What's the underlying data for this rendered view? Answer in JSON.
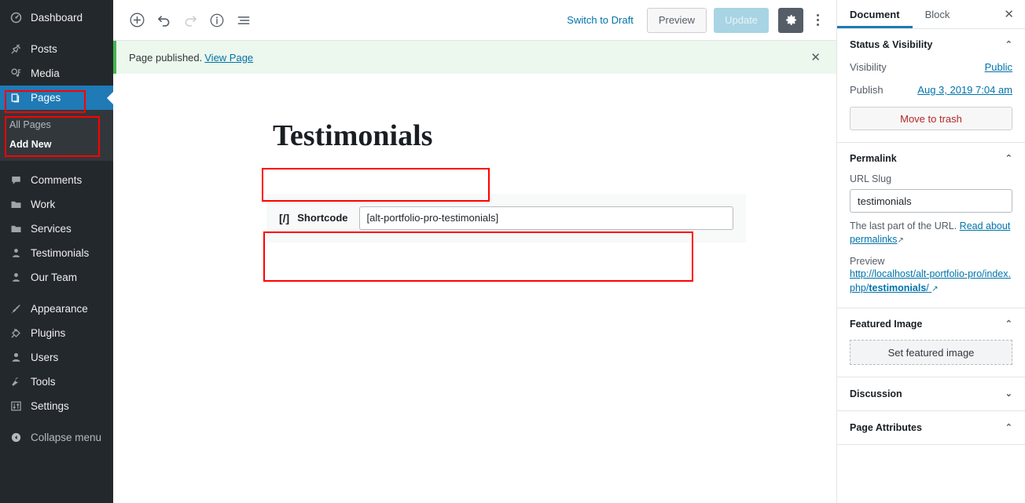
{
  "admin_menu": {
    "items": [
      {
        "label": "Dashboard",
        "icon": "dashboard-icon",
        "state": "normal"
      },
      {
        "label": "Posts",
        "icon": "pin-icon",
        "state": "normal"
      },
      {
        "label": "Media",
        "icon": "media-icon",
        "state": "normal"
      },
      {
        "label": "Pages",
        "icon": "pages-icon",
        "state": "current"
      },
      {
        "label": "Comments",
        "icon": "comment-icon",
        "state": "normal"
      },
      {
        "label": "Work",
        "icon": "folder-icon",
        "state": "normal"
      },
      {
        "label": "Services",
        "icon": "folder-icon",
        "state": "normal"
      },
      {
        "label": "Testimonials",
        "icon": "user-icon",
        "state": "normal"
      },
      {
        "label": "Our Team",
        "icon": "user-icon",
        "state": "normal"
      },
      {
        "label": "Appearance",
        "icon": "brush-icon",
        "state": "normal"
      },
      {
        "label": "Plugins",
        "icon": "plug-icon",
        "state": "normal"
      },
      {
        "label": "Users",
        "icon": "users-icon",
        "state": "normal"
      },
      {
        "label": "Tools",
        "icon": "wrench-icon",
        "state": "normal"
      },
      {
        "label": "Settings",
        "icon": "sliders-icon",
        "state": "normal"
      },
      {
        "label": "Collapse menu",
        "icon": "collapse-icon",
        "state": "collapse"
      }
    ],
    "submenu": {
      "items": [
        {
          "label": "All Pages",
          "current": false
        },
        {
          "label": "Add New",
          "current": true
        }
      ]
    },
    "highlight_color": "#1f7ab5",
    "background_color": "#23282d",
    "annotation_color": "#ff0000"
  },
  "toolbar": {
    "add_block_label": "+",
    "undo_label": "undo",
    "redo_label": "redo",
    "info_label": "info",
    "outline_label": "outline",
    "switch_to_draft": "Switch to Draft",
    "preview": "Preview",
    "update": "Update",
    "settings_label": "settings",
    "more_label": "more options"
  },
  "notice": {
    "message": "Page published.",
    "link": "View Page",
    "dismiss": "✕"
  },
  "editor": {
    "title": "Testimonials",
    "shortcode_block": {
      "icon_text": "[/]",
      "label": "Shortcode",
      "value": "[alt-portfolio-pro-testimonials]"
    }
  },
  "settings_sidebar": {
    "tabs": [
      {
        "label": "Document",
        "active": true
      },
      {
        "label": "Block",
        "active": false
      }
    ],
    "close": "✕",
    "status_visibility": {
      "title": "Status & Visibility",
      "chevron": "⌃",
      "visibility_label": "Visibility",
      "visibility_value": "Public",
      "publish_label": "Publish",
      "publish_value": "Aug 3, 2019 7:04 am",
      "trash_label": "Move to trash"
    },
    "permalink": {
      "title": "Permalink",
      "chevron": "⌃",
      "slug_label": "URL Slug",
      "slug_value": "testimonials",
      "help_prefix": "The last part of the URL.",
      "help_link": "Read about permalinks",
      "preview_label": "Preview",
      "preview_url_prefix": "http://localhost/alt-portfolio-pro/index.php/",
      "preview_url_slug": "testimonials",
      "preview_url_suffix": "/"
    },
    "featured_image": {
      "title": "Featured Image",
      "chevron": "⌃",
      "button_label": "Set featured image"
    },
    "discussion": {
      "title": "Discussion",
      "chevron": "⌄"
    },
    "page_attributes": {
      "title": "Page Attributes",
      "chevron": "⌃"
    }
  }
}
